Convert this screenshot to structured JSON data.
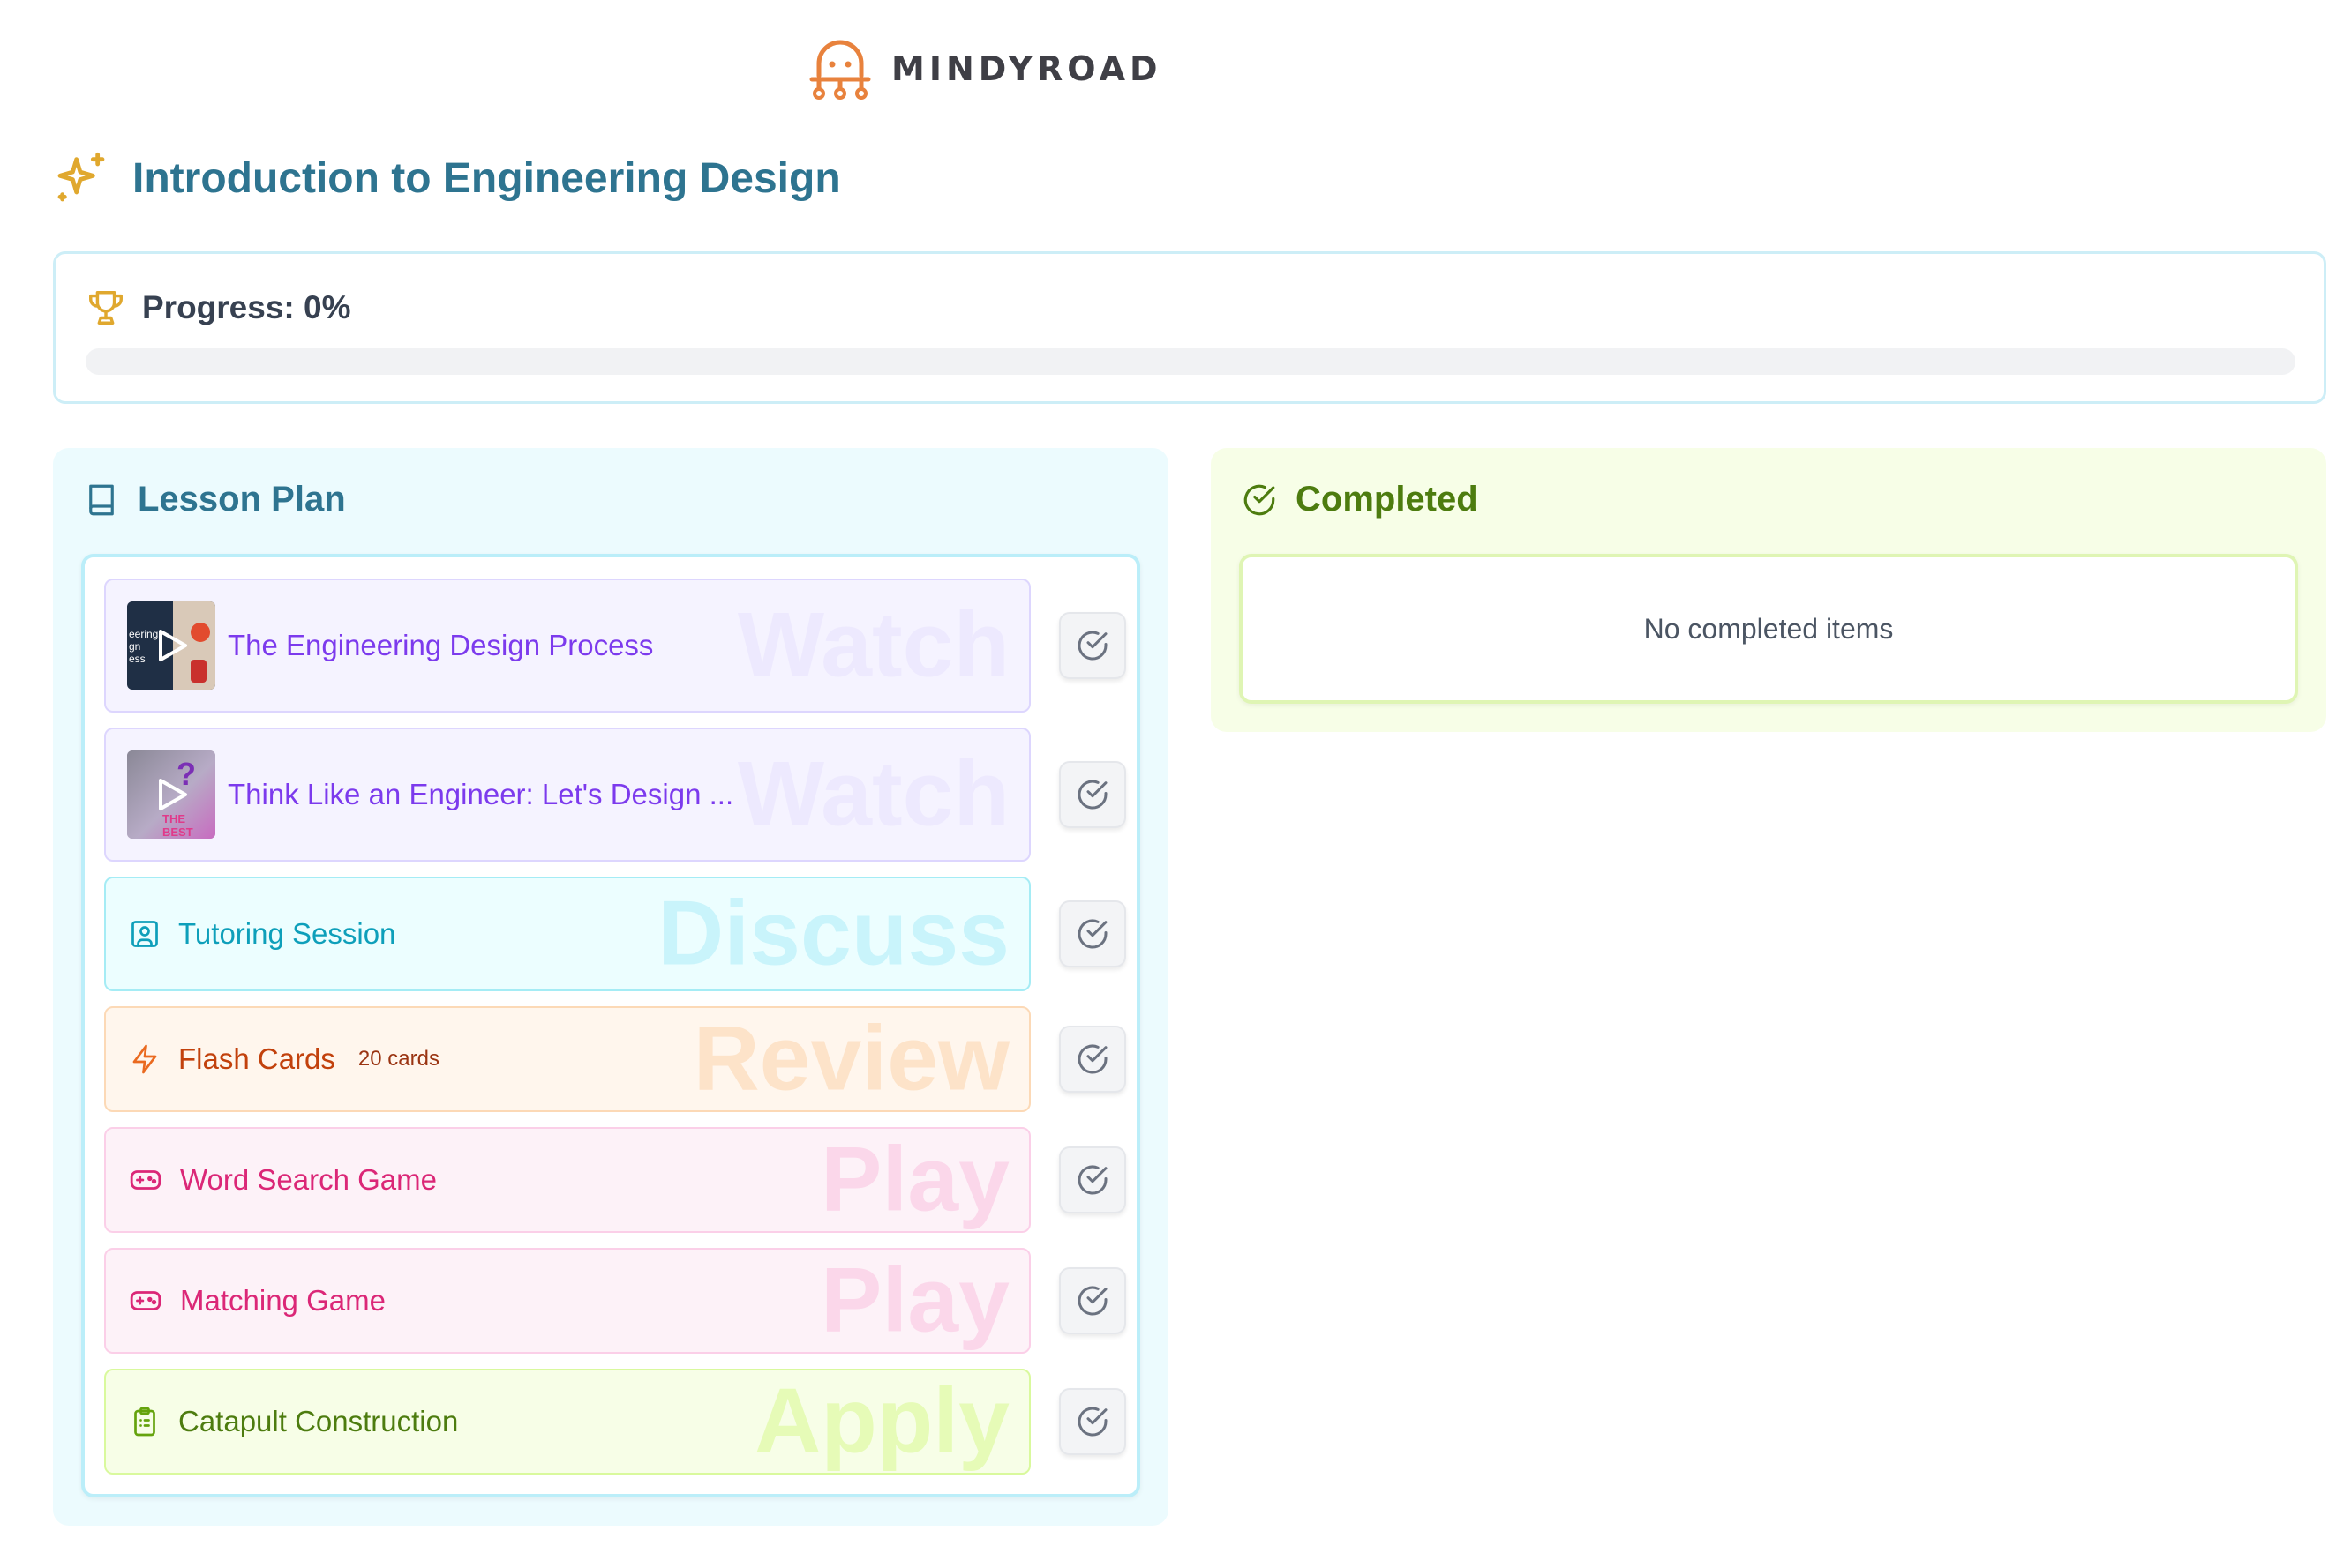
{
  "brand": {
    "name": "MINDYROAD",
    "accent": "#e8823d"
  },
  "page": {
    "title": "Introduction to Engineering Design"
  },
  "progress": {
    "label": "Progress: 0%",
    "value": 0
  },
  "lesson_plan": {
    "title": "Lesson Plan",
    "items": [
      {
        "type": "video",
        "label": "The Engineering Design Process",
        "badge": "Watch"
      },
      {
        "type": "video",
        "label": "Think Like an Engineer: Let's Design ...",
        "badge": "Watch"
      },
      {
        "type": "tutoring",
        "label": "Tutoring Session",
        "badge": "Discuss"
      },
      {
        "type": "flashcards",
        "label": "Flash Cards",
        "count": "20 cards",
        "badge": "Review"
      },
      {
        "type": "game",
        "label": "Word Search Game",
        "badge": "Play"
      },
      {
        "type": "game",
        "label": "Matching Game",
        "badge": "Play"
      },
      {
        "type": "project",
        "label": "Catapult Construction",
        "badge": "Apply"
      }
    ]
  },
  "completed": {
    "title": "Completed",
    "empty_text": "No completed items"
  },
  "thumbnails": {
    "video_1_text": [
      "eering",
      "gn",
      "ess"
    ],
    "video_2_text": "THE BEST"
  },
  "colors": {
    "title": "#2e7490",
    "completed_title": "#4d7c0f",
    "trophy": "#e0a82e",
    "sparkle": "#e0a82e"
  }
}
